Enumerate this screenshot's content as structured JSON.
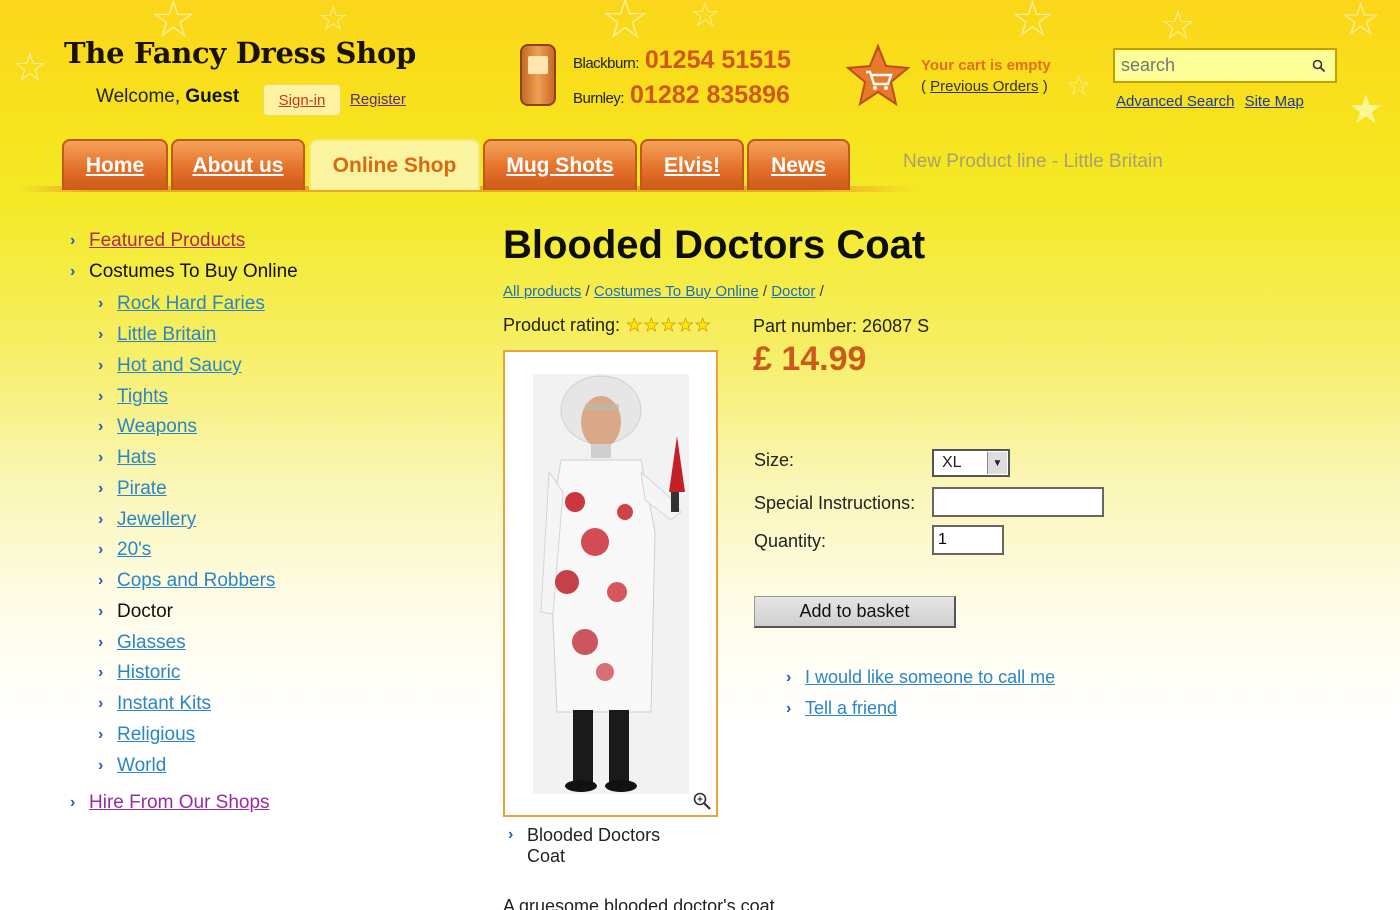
{
  "header": {
    "logo": "The Fancy Dress Shop",
    "welcome_prefix": "Welcome,",
    "welcome_user": "Guest",
    "signin": "Sign-in",
    "register": "Register"
  },
  "contact": {
    "blackburn_label": "Blackburn:",
    "blackburn_number": "01254 51515",
    "burnley_label": "Burnley:",
    "burnley_number": "01282 835896"
  },
  "cart": {
    "status": "Your cart is empty",
    "paren_open": "(",
    "previous_orders": "Previous Orders",
    "paren_close": ")"
  },
  "search": {
    "placeholder": "search",
    "advanced": "Advanced Search",
    "sitemap": "Site Map"
  },
  "nav": {
    "tabs": [
      "Home",
      "About us",
      "Online Shop",
      "Mug Shots",
      "Elvis!",
      "News"
    ],
    "active": "Online Shop",
    "promo": "New Product line - Little Britain"
  },
  "sidebar": {
    "featured": "Featured Products",
    "costumes_heading": "Costumes To Buy Online",
    "items": [
      "Rock Hard Faries",
      "Little Britain",
      "Hot and Saucy",
      "Tights",
      "Weapons",
      "Hats",
      "Pirate",
      "Jewellery",
      "20's",
      "Cops and Robbers",
      "Doctor",
      "Glasses",
      "Historic",
      "Instant Kits",
      "Religious",
      "World"
    ],
    "current": "Doctor",
    "hire": "Hire From Our Shops"
  },
  "product": {
    "title": "Blooded Doctors Coat",
    "breadcrumb": [
      "All products",
      "Costumes To Buy Online",
      "Doctor"
    ],
    "breadcrumb_sep": "/",
    "rating_label": "Product rating:",
    "rating_value": 5,
    "rating_max": 5,
    "part_number": "Part number: 26087 S",
    "price": "£ 14.99",
    "caption": "Blooded Doctors Coat",
    "description": "A gruesome blooded doctor's coat"
  },
  "form": {
    "size_label": "Size:",
    "size_value": "XL",
    "instructions_label": "Special Instructions:",
    "instructions_value": "",
    "quantity_label": "Quantity:",
    "quantity_value": "1",
    "add_button": "Add to basket"
  },
  "actions": {
    "call_me": "I would like someone to call me",
    "tell_friend": "Tell a friend"
  },
  "colors": {
    "accent_orange": "#e4722a",
    "price": "#cc5a1c",
    "link_blue": "#2a86c6",
    "bg_yellow": "#f4ea26"
  }
}
